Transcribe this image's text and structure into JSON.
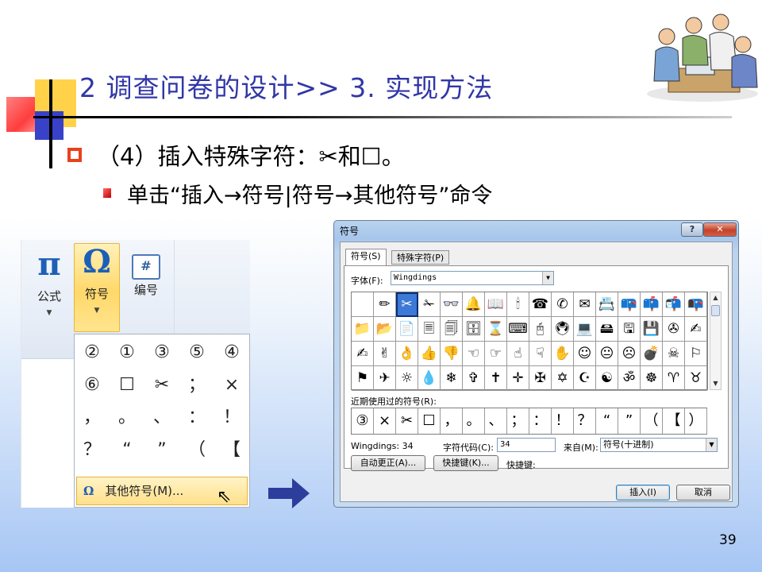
{
  "slide": {
    "title": "2 调查问卷的设计>> 3. 实现方法",
    "bullet1": "（4）插入特殊字符：✂和☐。",
    "bullet2": "单击“插入→符号|符号→其他符号”命令",
    "page_number": "39"
  },
  "ribbon": {
    "formula_icon": "π",
    "formula_label": "公式",
    "symbol_icon": "Ω",
    "symbol_label": "符号",
    "numbering_icon": "#",
    "numbering_label": "编号",
    "symbols": [
      "②",
      "①",
      "③",
      "⑤",
      "④",
      "⑥",
      "☐",
      "✂",
      "；",
      "×",
      "，",
      "。",
      "、",
      "：",
      "！",
      "？",
      "“",
      "”",
      "（",
      "【"
    ],
    "more_icon": "Ω",
    "more_label": "其他符号(M)..."
  },
  "dialog": {
    "title": "符号",
    "help_button": "?",
    "close_button": "✕",
    "tabs": [
      "符号(S)",
      "特殊字符(P)"
    ],
    "font_label": "字体(F):",
    "font_value": "Wingdings",
    "glyphs": [
      "",
      "✏",
      "✂",
      "✁",
      "👓",
      "🔔",
      "📖",
      "🕯",
      "☎",
      "✆",
      "✉",
      "📇",
      "📪",
      "📫",
      "📬",
      "📭",
      "📁",
      "📂",
      "📄",
      "🗏",
      "🗐",
      "🗄",
      "⌛",
      "⌨",
      "🖰",
      "🖲",
      "💻",
      "🖴",
      "🖫",
      "💾",
      "✇",
      "✍",
      "✍",
      "✌",
      "👌",
      "👍",
      "👎",
      "☜",
      "☞",
      "☝",
      "☟",
      "✋",
      "☺",
      "😐",
      "☹",
      "💣",
      "☠",
      "⚐",
      "⚑",
      "✈",
      "☼",
      "💧",
      "❄",
      "✞",
      "✝",
      "✛",
      "✠",
      "✡",
      "☪",
      "☯",
      "ॐ",
      "☸",
      "♈",
      "♉"
    ],
    "selected_index": 2,
    "recent_label": "近期使用过的符号(R):",
    "recent": [
      "③",
      "×",
      "✂",
      "☐",
      "，",
      "。",
      "、",
      "；",
      "：",
      "！",
      "？",
      "“",
      "”",
      "（",
      "【",
      "）"
    ],
    "char_name": "Wingdings: 34",
    "char_code_label": "字符代码(C):",
    "char_code_value": "34",
    "from_label": "来自(M):",
    "from_value": "符号(十进制)",
    "autocorrect_button": "自动更正(A)...",
    "shortcut_button": "快捷键(K)...",
    "shortcut_label": "快捷键:",
    "insert_button": "插入(I)",
    "cancel_button": "取消"
  }
}
